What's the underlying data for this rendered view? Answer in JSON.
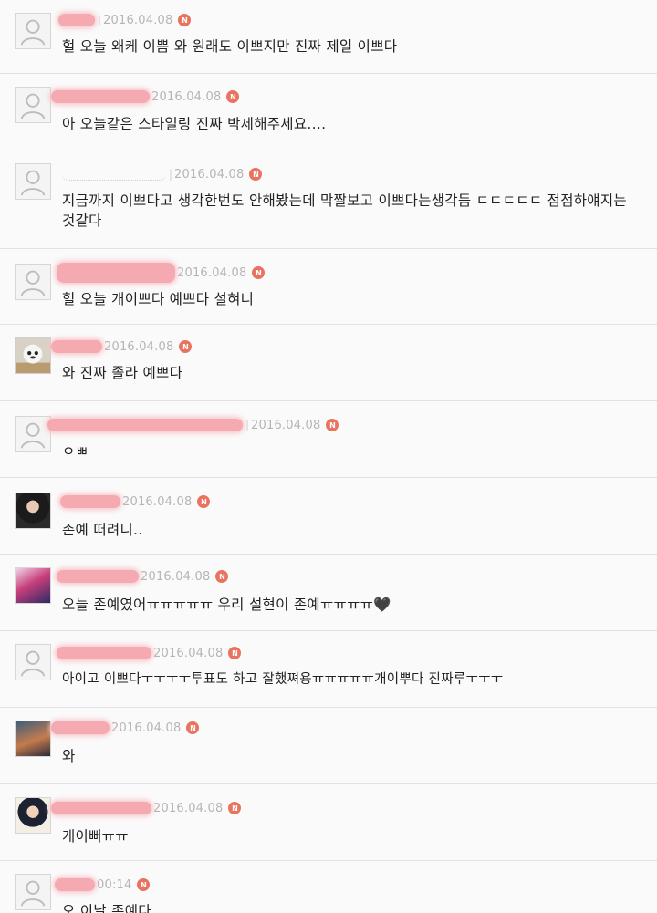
{
  "comments": [
    {
      "date": "2016.04.08",
      "text": "헐 오늘 왜케 이쁨 와 원래도 이쁘지만 진짜 제일 이쁘다",
      "avatar": "default-avatar-icon",
      "badge": "N"
    },
    {
      "date": "2016.04.08",
      "text": "아 오늘같은 스타일링 진짜 박제해주세요....",
      "avatar": "default-avatar-icon",
      "badge": "N"
    },
    {
      "date": "2016.04.08",
      "text": "지금까지 이쁘다고 생각한번도 안해봤는데 막짤보고 이쁘다는생각듬 ㄷㄷㄷㄷㄷ 점점하얘지는것같다",
      "avatar": "default-avatar-icon",
      "badge": "N"
    },
    {
      "date": "2016.04.08",
      "text": "헐 오늘 개이쁘다 예쁘다 설혀니",
      "avatar": "default-avatar-icon",
      "badge": "N"
    },
    {
      "date": "2016.04.08",
      "text": "와 진짜 졸라 예쁘다",
      "avatar": "profile-photo",
      "badge": "N"
    },
    {
      "date": "2016.04.08",
      "text": "ㅇㅃ",
      "avatar": "default-avatar-icon",
      "badge": "N"
    },
    {
      "date": "2016.04.08",
      "text": "존예 떠려니..",
      "avatar": "profile-photo",
      "badge": "N"
    },
    {
      "date": "2016.04.08",
      "text": "오늘 존예였어ㅠㅠㅠㅠㅠ 우리 설현이 존예ㅠㅠㅠㅠ🖤",
      "avatar": "profile-photo",
      "badge": "N"
    },
    {
      "date": "2016.04.08",
      "text": "아이고 이쁘다ㅜㅜㅜㅜ투표도 하고 잘했쪄용ㅠㅠㅠㅠㅠ개이뿌다 진짜루ㅜㅜㅜ",
      "avatar": "default-avatar-icon",
      "badge": "N"
    },
    {
      "date": "2016.04.08",
      "text": "와",
      "avatar": "profile-photo",
      "badge": "N"
    },
    {
      "date": "2016.04.08",
      "text": "개이뻐ㅠㅠ",
      "avatar": "profile-photo",
      "badge": "N"
    },
    {
      "date": "00:14",
      "text": "오 이날 존예다",
      "avatar": "default-avatar-icon",
      "badge": "N"
    }
  ],
  "colors": {
    "badge": "#e8735f",
    "date": "#b5b5b5",
    "divider": "#e2e2e2",
    "background": "#fafafa",
    "redaction": "#f4a6ad"
  }
}
